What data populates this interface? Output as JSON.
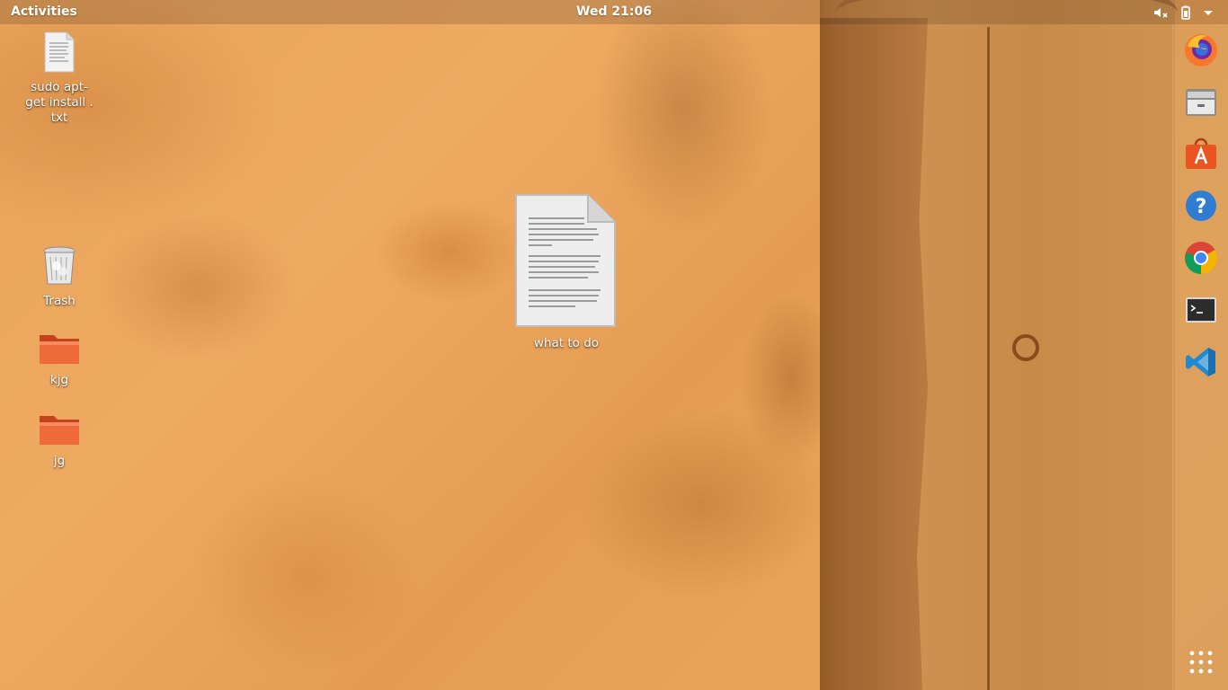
{
  "top_bar": {
    "activities_label": "Activities",
    "clock": "Wed 21:06",
    "tray": {
      "volume_icon": "volume-muted-icon",
      "battery_icon": "battery-icon",
      "menu_icon": "system-menu-arrow-icon"
    }
  },
  "desktop": {
    "icons": [
      {
        "label": "sudo apt-get install . txt",
        "icon": "text-file-icon"
      },
      {
        "label": "Trash",
        "icon": "trash-icon"
      },
      {
        "label": "kjg",
        "icon": "folder-icon"
      },
      {
        "label": "jg",
        "icon": "folder-icon"
      },
      {
        "label": "what to do",
        "icon": "document-icon"
      }
    ]
  },
  "dock": {
    "apps": [
      {
        "name": "firefox",
        "icon": "firefox-icon"
      },
      {
        "name": "files",
        "icon": "files-icon"
      },
      {
        "name": "software",
        "icon": "software-center-icon"
      },
      {
        "name": "help",
        "icon": "help-icon"
      },
      {
        "name": "chrome",
        "icon": "chrome-icon"
      },
      {
        "name": "terminal",
        "icon": "terminal-icon"
      },
      {
        "name": "vscode",
        "icon": "vscode-icon"
      }
    ],
    "show_apps_icon": "app-grid-icon"
  },
  "colors": {
    "wall": "#eaa35a",
    "folder": "#e8572a",
    "dock_bg": "#c8a064"
  }
}
